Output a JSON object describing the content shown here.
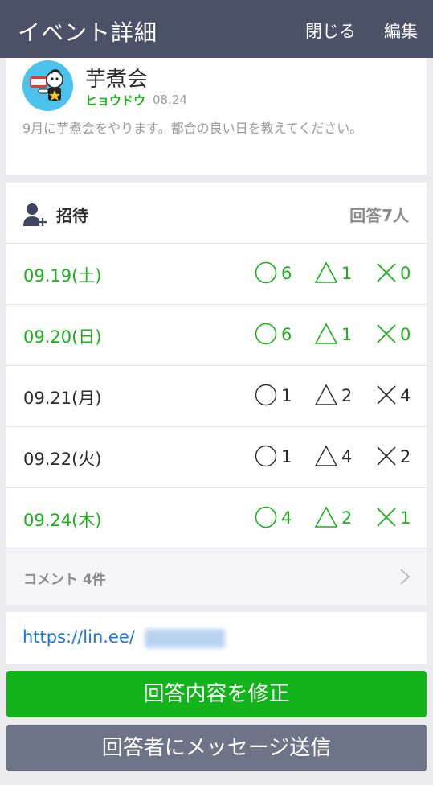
{
  "header": {
    "title": "イベント詳細",
    "close_label": "閉じる",
    "edit_label": "編集"
  },
  "event": {
    "title": "芋煮会",
    "author": "ヒョウドウ",
    "date": "08.24",
    "description": "9月に芋煮会をやります。都合の良い日を教えてください。"
  },
  "invite": {
    "label": "招待",
    "responses": "回答7人",
    "rows": [
      {
        "date": "09.19(土)",
        "ok": "6",
        "maybe": "1",
        "no": "0",
        "highlight": true
      },
      {
        "date": "09.20(日)",
        "ok": "6",
        "maybe": "1",
        "no": "0",
        "highlight": true
      },
      {
        "date": "09.21(月)",
        "ok": "1",
        "maybe": "2",
        "no": "4",
        "highlight": false
      },
      {
        "date": "09.22(火)",
        "ok": "1",
        "maybe": "4",
        "no": "2",
        "highlight": false
      },
      {
        "date": "09.24(木)",
        "ok": "4",
        "maybe": "2",
        "no": "1",
        "highlight": true
      }
    ]
  },
  "comments": {
    "label": "コメント 4件"
  },
  "link": {
    "url": "https://lin.ee/"
  },
  "buttons": {
    "edit_response": "回答内容を修正",
    "message_responders": "回答者にメッセージ送信"
  },
  "colors": {
    "header": "#4b5167",
    "accent": "#19b219",
    "button_green": "#13b31b",
    "button_gray": "#6e7488"
  }
}
